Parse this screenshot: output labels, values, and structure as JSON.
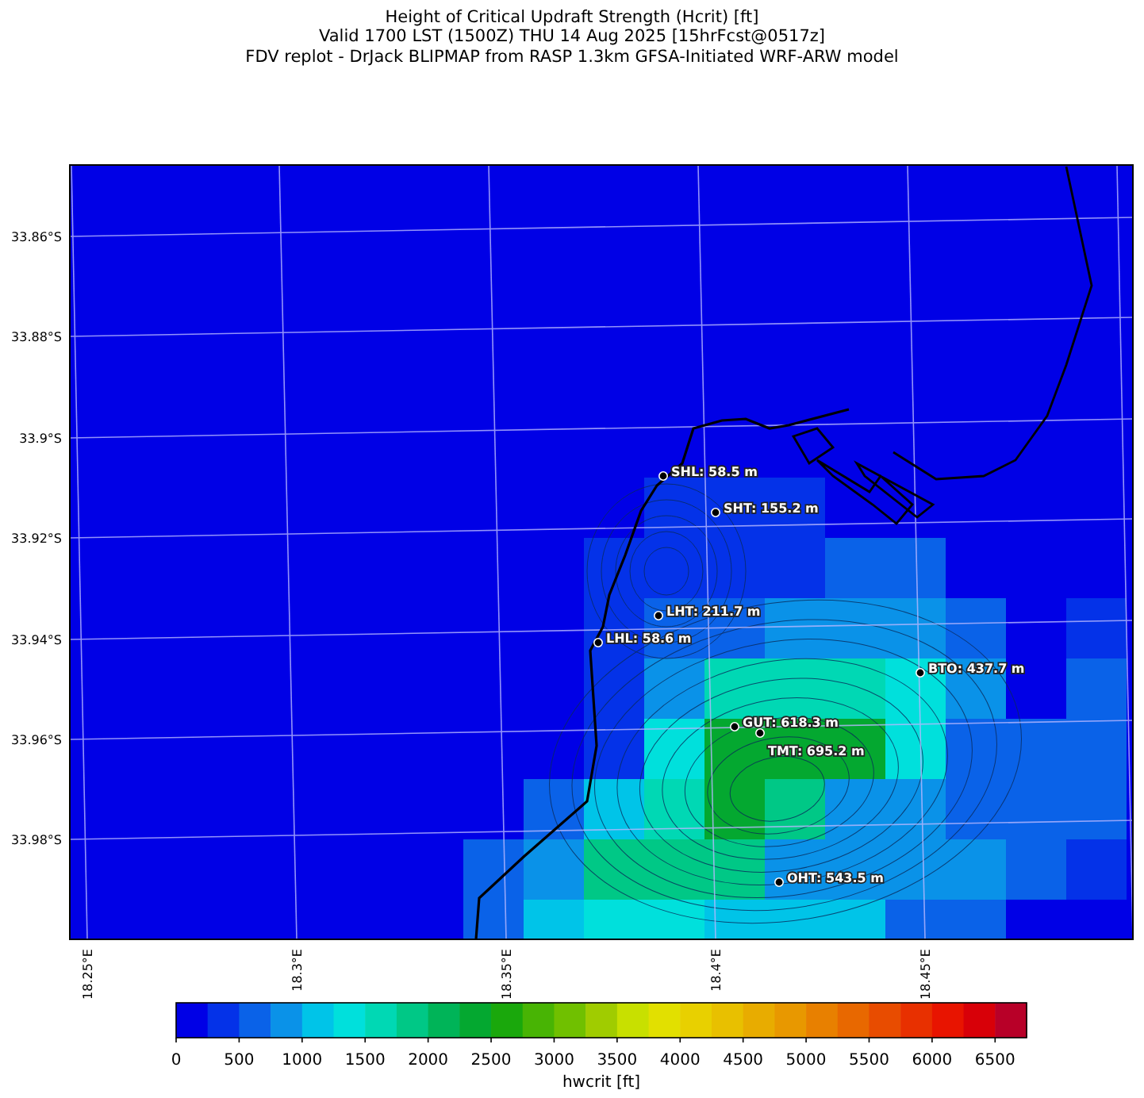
{
  "figure": {
    "title_lines": [
      "Height of Critical Updraft Strength (Hcrit) [ft]",
      "Valid 1700 LST (1500Z) THU 14 Aug 2025 [15hrFcst@0517z]",
      "FDV replot - DrJack BLIPMAP from RASP 1.3km GFSA-Initiated WRF-ARW model"
    ]
  },
  "map": {
    "latitude_labels": [
      "33.86°S",
      "33.88°S",
      "33.9°S",
      "33.92°S",
      "33.94°S",
      "33.96°S",
      "33.98°S"
    ],
    "longitude_labels": [
      "18.25°E",
      "18.3°E",
      "18.35°E",
      "18.4°E",
      "18.45°E"
    ],
    "stations": [
      {
        "label": "SHL: 58.5 m"
      },
      {
        "label": "SHT: 155.2 m"
      },
      {
        "label": "LHT: 211.7 m"
      },
      {
        "label": "LHL: 58.6 m"
      },
      {
        "label": "BTO: 437.7 m"
      },
      {
        "label": "GUT: 618.3 m"
      },
      {
        "label": "TMT: 695.2 m"
      },
      {
        "label": "OHT: 543.5 m"
      }
    ]
  },
  "colorbar": {
    "label": "hwcrit [ft]",
    "segments": [
      {
        "color": "#0000e6"
      },
      {
        "color": "#0432e8"
      },
      {
        "color": "#0a62e8"
      },
      {
        "color": "#0a92e8"
      },
      {
        "color": "#00c4e8"
      },
      {
        "color": "#00e0dc"
      },
      {
        "color": "#00d8b4"
      },
      {
        "color": "#00c886"
      },
      {
        "color": "#00b458"
      },
      {
        "color": "#04a830"
      },
      {
        "color": "#1aa80c"
      },
      {
        "color": "#48b404"
      },
      {
        "color": "#70c000"
      },
      {
        "color": "#a0cc00"
      },
      {
        "color": "#c8e000"
      },
      {
        "color": "#e2e000"
      },
      {
        "color": "#e8d000"
      },
      {
        "color": "#e8c000"
      },
      {
        "color": "#e8ac00"
      },
      {
        "color": "#e89800"
      },
      {
        "color": "#e88000"
      },
      {
        "color": "#e86800"
      },
      {
        "color": "#e84c00"
      },
      {
        "color": "#e83000"
      },
      {
        "color": "#e81400"
      },
      {
        "color": "#d80008"
      },
      {
        "color": "#b80028"
      }
    ],
    "ticks": [
      "0",
      "500",
      "1000",
      "1500",
      "2000",
      "2500",
      "3000",
      "3500",
      "4000",
      "4500",
      "5000",
      "5500",
      "6000",
      "6500"
    ]
  }
}
